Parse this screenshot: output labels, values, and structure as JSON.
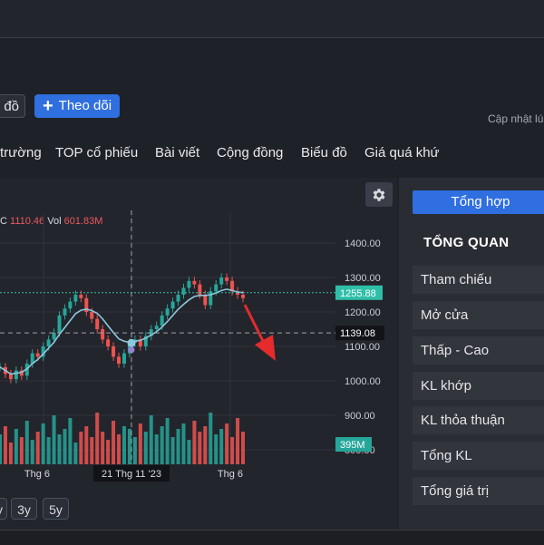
{
  "toolbar": {
    "map_label": "đồ",
    "follow_label": "Theo dõi",
    "update_text": "Cập nhật lú"
  },
  "nav": {
    "items": [
      "trường",
      "TOP cổ phiếu",
      "Bài viết",
      "Cộng đồng",
      "Biểu đồ",
      "Giá quá khứ"
    ]
  },
  "legend": {
    "prefix": "C",
    "close_value": "1110.46",
    "vol_label": "Vol",
    "vol_value": "601.83M"
  },
  "chart_data": {
    "type": "line",
    "y_ticks": [
      "1400.00",
      "1300.00",
      "1200.00",
      "1100.00",
      "1000.00",
      "900.00",
      "800.00"
    ],
    "ylim": [
      800,
      1430
    ],
    "x_ticks": [
      "Thg 6",
      "21 Thg 11 '23",
      "Thg 6"
    ],
    "price_label": "1255.88",
    "crosshair_label": "1139.08",
    "volume_label": "395M",
    "price": [
      1040,
      1020,
      1005,
      1030,
      1015,
      1050,
      1080,
      1070,
      1100,
      1120,
      1140,
      1190,
      1210,
      1230,
      1250,
      1240,
      1200,
      1180,
      1150,
      1120,
      1100,
      1070,
      1050,
      1080,
      1110,
      1120,
      1100,
      1130,
      1150,
      1160,
      1190,
      1210,
      1230,
      1250,
      1270,
      1290,
      1280,
      1250,
      1220,
      1260,
      1280,
      1300,
      1290,
      1260,
      1250,
      1240
    ],
    "ma": [
      1040,
      1030,
      1020,
      1022,
      1025,
      1035,
      1050,
      1062,
      1078,
      1095,
      1112,
      1135,
      1155,
      1175,
      1195,
      1205,
      1208,
      1204,
      1196,
      1180,
      1160,
      1140,
      1122,
      1115,
      1112,
      1115,
      1118,
      1124,
      1133,
      1143,
      1156,
      1172,
      1190,
      1208,
      1222,
      1235,
      1245,
      1248,
      1248,
      1250,
      1255,
      1262,
      1266,
      1262,
      1258,
      1256
    ],
    "volume": [
      0.55,
      0.7,
      0.4,
      0.65,
      0.5,
      0.8,
      0.45,
      0.6,
      0.75,
      0.5,
      0.9,
      0.55,
      0.65,
      0.85,
      0.4,
      0.6,
      0.7,
      0.5,
      0.95,
      0.6,
      0.45,
      0.8,
      0.55,
      0.7,
      0.65,
      0.5,
      0.75,
      0.6,
      0.9,
      0.55,
      0.7,
      0.85,
      0.5,
      0.65,
      0.75,
      0.45,
      0.8,
      0.6,
      0.7,
      0.95,
      0.55,
      0.65,
      0.75,
      0.5,
      0.85,
      0.6
    ],
    "colors": {
      "up": "#26a69a",
      "down": "#ef5350",
      "ma": "#8fc7dc",
      "price_line": "#2fbfa8"
    }
  },
  "right_panel": {
    "tab_label": "Tổng hợp",
    "overview_title": "TỔNG QUAN",
    "rows": [
      "Tham chiếu",
      "Mở cửa",
      "Thấp - Cao",
      "KL khớp",
      "KL thỏa thuận",
      "Tổng KL",
      "Tổng giá trị"
    ]
  },
  "ranges": [
    "y",
    "3y",
    "5y"
  ]
}
